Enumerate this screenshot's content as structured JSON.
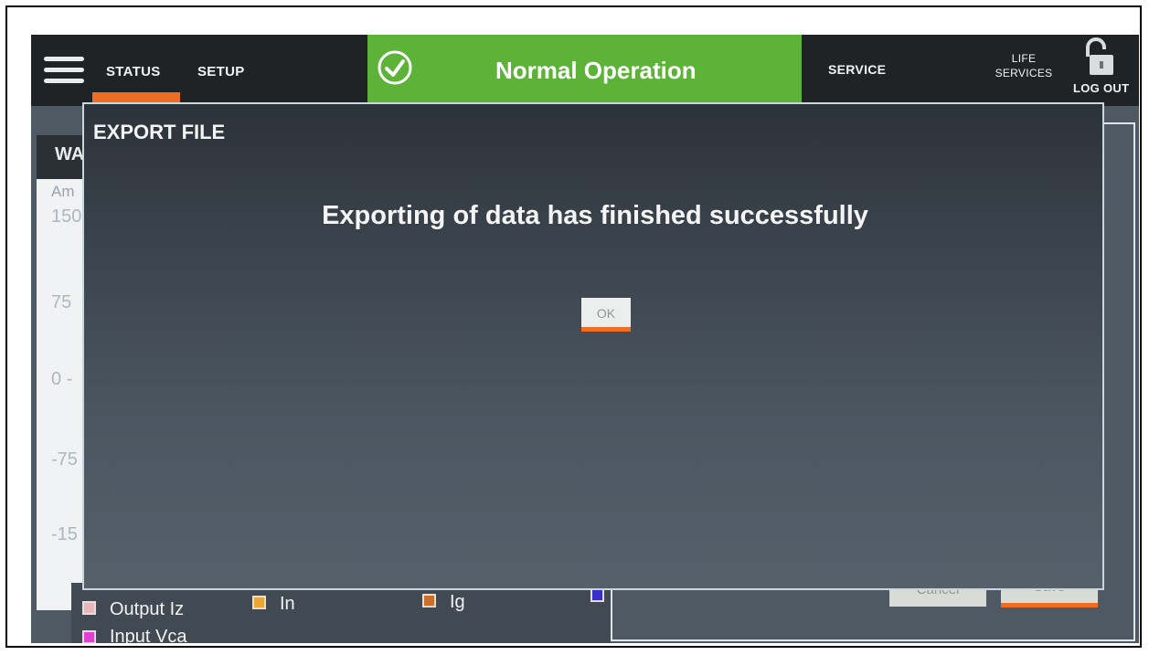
{
  "nav": {
    "status_label": "STATUS",
    "setup_label": "SETUP",
    "service_label": "SERVICE",
    "life_services_label_line1": "LIFE",
    "life_services_label_line2": "SERVICES",
    "logout_label": "LOG OUT"
  },
  "status_banner": {
    "text": "Normal Operation",
    "color": "#5db238"
  },
  "background": {
    "panel_title_partial": "WA",
    "axis_label_partial": "Am",
    "y_ticks": [
      "150",
      "75",
      "0 -",
      "-75",
      "-15"
    ],
    "legend": [
      {
        "label": "Output Iz",
        "color": "#e8b7bb"
      },
      {
        "label": "In",
        "color": "#e9a536"
      },
      {
        "label": "Ig",
        "color": "#c8702c"
      },
      {
        "label": "",
        "color": "#3a2fc9"
      },
      {
        "label": "Input Vca",
        "color": "#e041d0"
      },
      {
        "label": "",
        "color": "#1f4fe0"
      }
    ],
    "cancel_label": "Cancel",
    "save_label": "Save"
  },
  "modal": {
    "title": "EXPORT FILE",
    "message": "Exporting of data has finished successfully",
    "ok_label": "OK"
  },
  "colors": {
    "accent_orange": "#ef6c23",
    "topbar": "#1f2326",
    "screen_bg": "#4f5964"
  }
}
